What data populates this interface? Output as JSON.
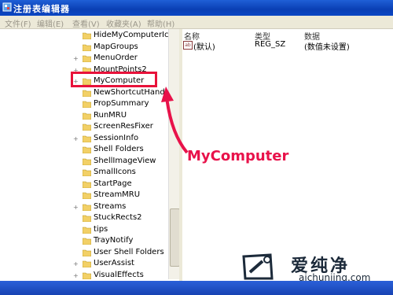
{
  "window": {
    "title": "注册表编辑器"
  },
  "menu": [
    "文件(F)",
    "编辑(E)",
    "查看(V)",
    "收藏夹(A)",
    "帮助(H)"
  ],
  "tree": {
    "items": [
      {
        "label": "HideMyComputerIcons",
        "expander": ""
      },
      {
        "label": "MapGroups",
        "expander": ""
      },
      {
        "label": "MenuOrder",
        "expander": "+"
      },
      {
        "label": "MountPoints2",
        "expander": "+"
      },
      {
        "label": "MyComputer",
        "expander": "+",
        "selected": true
      },
      {
        "label": "NewShortcutHandlers",
        "expander": ""
      },
      {
        "label": "PropSummary",
        "expander": ""
      },
      {
        "label": "RunMRU",
        "expander": ""
      },
      {
        "label": "ScreenResFixer",
        "expander": ""
      },
      {
        "label": "SessionInfo",
        "expander": "+"
      },
      {
        "label": "Shell Folders",
        "expander": ""
      },
      {
        "label": "ShellImageView",
        "expander": ""
      },
      {
        "label": "SmallIcons",
        "expander": ""
      },
      {
        "label": "StartPage",
        "expander": ""
      },
      {
        "label": "StreamMRU",
        "expander": ""
      },
      {
        "label": "Streams",
        "expander": "+"
      },
      {
        "label": "StuckRects2",
        "expander": ""
      },
      {
        "label": "tips",
        "expander": ""
      },
      {
        "label": "TrayNotify",
        "expander": ""
      },
      {
        "label": "User Shell Folders",
        "expander": ""
      },
      {
        "label": "UserAssist",
        "expander": "+"
      },
      {
        "label": "VisualEffects",
        "expander": "+"
      }
    ]
  },
  "values": {
    "headers": [
      "名称",
      "类型",
      "数据"
    ],
    "rows": [
      {
        "name": "(默认)",
        "type": "REG_SZ",
        "data": "(数值未设置)"
      }
    ]
  },
  "annotation": {
    "callout": "MyComputer",
    "color": "#e8124a"
  },
  "watermark": {
    "brand": "爱纯净",
    "url": "aichunjing.com"
  },
  "colors": {
    "titlebar": "#0a3fb4",
    "folder": "#f2d067",
    "highlight": "#e8123a"
  },
  "icons": {
    "app": "regedit-icon",
    "folder": "folder-icon",
    "value": "string-value-icon"
  }
}
